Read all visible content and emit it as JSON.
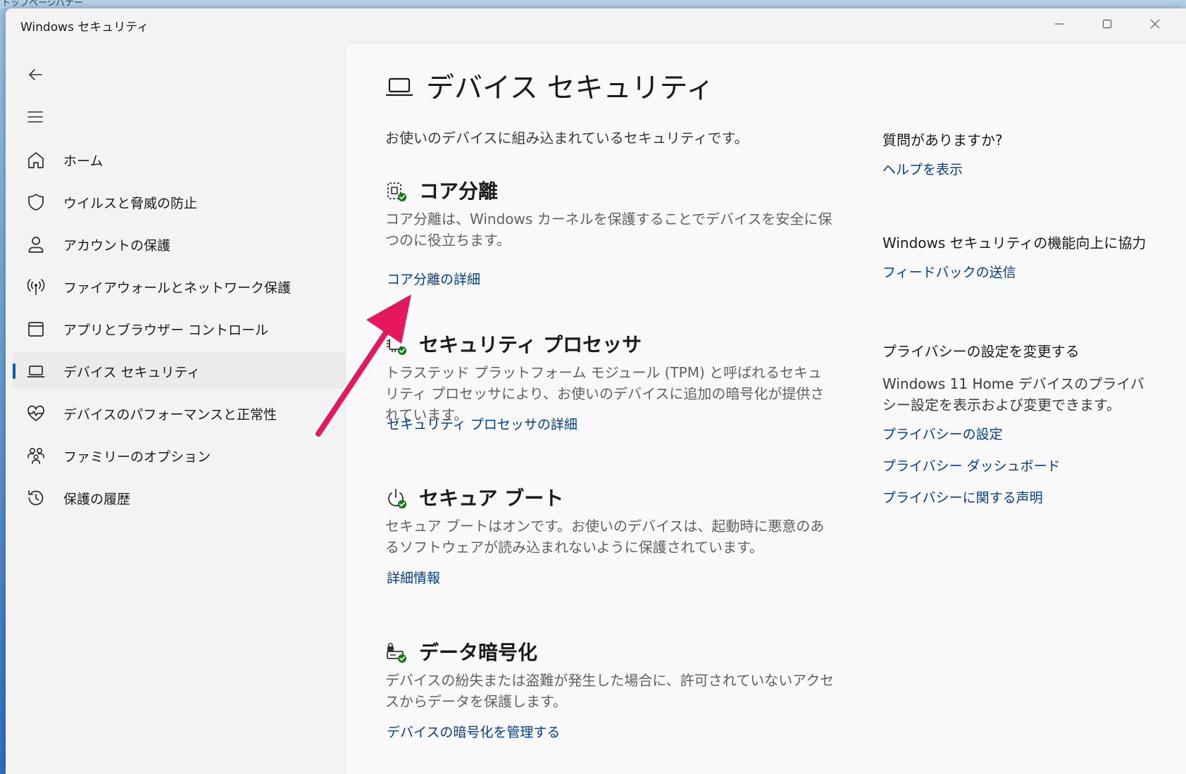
{
  "desktop": {
    "label": "トップページバナー"
  },
  "window": {
    "title": "Windows セキュリティ",
    "controls": {
      "minimize": "minimize-icon",
      "maximize": "maximize-icon",
      "close": "close-icon"
    }
  },
  "nav": {
    "items": [
      {
        "label": "ホーム",
        "icon": "home-icon"
      },
      {
        "label": "ウイルスと脅威の防止",
        "icon": "shield-icon"
      },
      {
        "label": "アカウントの保護",
        "icon": "person-icon"
      },
      {
        "label": "ファイアウォールとネットワーク保護",
        "icon": "antenna-icon"
      },
      {
        "label": "アプリとブラウザー コントロール",
        "icon": "browser-window-icon"
      },
      {
        "label": "デバイス セキュリティ",
        "icon": "laptop-icon",
        "selected": true
      },
      {
        "label": "デバイスのパフォーマンスと正常性",
        "icon": "heart-pulse-icon"
      },
      {
        "label": "ファミリーのオプション",
        "icon": "family-icon"
      },
      {
        "label": "保護の履歴",
        "icon": "history-icon"
      }
    ]
  },
  "main": {
    "title": "デバイス セキュリティ",
    "description": "お使いのデバイスに組み込まれているセキュリティです。",
    "sections": [
      {
        "title": "コア分離",
        "description": "コア分離は、Windows カーネルを保護することでデバイスを安全に保つのに役立ちます。",
        "link": "コア分離の詳細",
        "icon": "core-isolation-icon"
      },
      {
        "title": "セキュリティ プロセッサ",
        "description": "トラステッド プラットフォーム モジュール (TPM) と呼ばれるセキュリティ プロセッサにより、お使いのデバイスに追加の暗号化が提供されています。",
        "link": "セキュリティ プロセッサの詳細",
        "icon": "chip-icon"
      },
      {
        "title": "セキュア ブート",
        "description": "セキュア ブートはオンです。お使いのデバイスは、起動時に悪意のあるソフトウェアが読み込まれないように保護されています。",
        "link": "詳細情報",
        "icon": "power-icon"
      },
      {
        "title": "データ暗号化",
        "description": "デバイスの紛失または盗難が発生した場合に、許可されていないアクセスからデータを保護します。",
        "link": "デバイスの暗号化を管理する",
        "icon": "encryption-icon"
      }
    ]
  },
  "sidebar": {
    "help": {
      "heading": "質問がありますか?",
      "link": "ヘルプを表示"
    },
    "feedback": {
      "heading": "Windows セキュリティの機能向上に協力",
      "link": "フィードバックの送信"
    },
    "privacy": {
      "heading": "プライバシーの設定を変更する",
      "text": "Windows 11 Home デバイスのプライバシー設定を表示および変更できます。",
      "links": [
        "プライバシーの設定",
        "プライバシー ダッシュボード",
        "プライバシーに関する声明"
      ]
    }
  },
  "colors": {
    "accent": "#005fb8",
    "link": "#003e92",
    "status_ok": "#107c10",
    "annotation_arrow": "#e8175d"
  }
}
